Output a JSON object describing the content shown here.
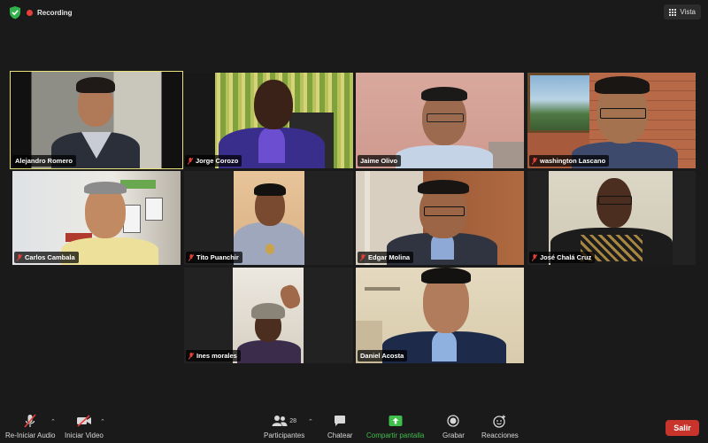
{
  "app": {
    "recording_label": "Recording",
    "view_label": "Vista",
    "accent_active_speaker": "#e9e07a",
    "recording_color": "#e5403a",
    "leave_color": "#c8342b"
  },
  "participants": [
    {
      "name": "Alejandro Romero",
      "muted": false,
      "active": true
    },
    {
      "name": "Jorge Corozo",
      "muted": true,
      "active": false
    },
    {
      "name": "Jaime Olivo",
      "muted": false,
      "active": false
    },
    {
      "name": "washington Lascano",
      "muted": true,
      "active": false
    },
    {
      "name": "Carlos Cambala",
      "muted": true,
      "active": false
    },
    {
      "name": "Tito Puanchir",
      "muted": true,
      "active": false
    },
    {
      "name": "Edgar Molina",
      "muted": true,
      "active": false
    },
    {
      "name": "José Chalá Cruz",
      "muted": true,
      "active": false
    },
    {
      "name": "Ines morales",
      "muted": true,
      "active": false
    },
    {
      "name": "Daniel Acosta",
      "muted": false,
      "active": false
    }
  ],
  "toolbar": {
    "audio_label": "Re-Iniciar Audio",
    "video_label": "Iniciar Video",
    "participants_label": "Participantes",
    "participants_count": "28",
    "chat_label": "Chatear",
    "share_label": "Compartir pantalla",
    "record_label": "Grabar",
    "reactions_label": "Reacciones",
    "leave_label": "Salir",
    "share_color": "#3fbf4c"
  },
  "icons": {
    "security": "shield-check-icon",
    "view": "grid-icon",
    "audio": "microphone-muted-icon",
    "video": "camera-off-icon",
    "participants": "people-icon",
    "chat": "chat-bubble-icon",
    "share": "share-screen-arrow-icon",
    "record": "record-icon",
    "reactions": "smile-add-icon"
  }
}
